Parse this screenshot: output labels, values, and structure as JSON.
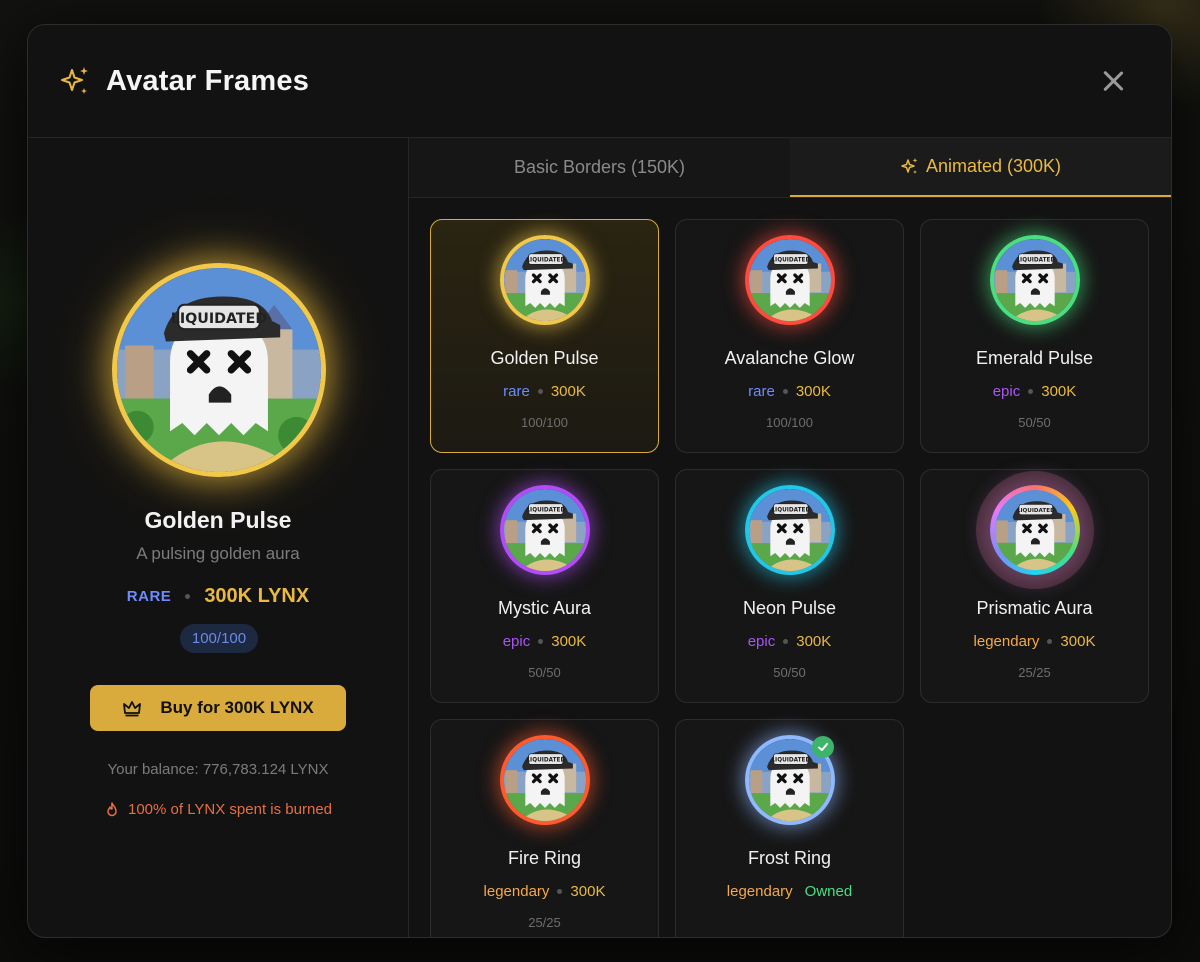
{
  "modal": {
    "title": "Avatar Frames",
    "close_icon": "close-icon",
    "title_icon": "sparkles-icon"
  },
  "preview": {
    "name": "Golden Pulse",
    "description": "A pulsing golden aura",
    "rarity": "RARE",
    "price": "300K LYNX",
    "stock": "100/100",
    "buy_label": "Buy for 300K LYNX",
    "balance": "Your balance: 776,783.124 LYNX",
    "burn_note": "100% of LYNX spent is burned",
    "avatar_cap_text": "LIQUIDATED"
  },
  "tabs": [
    {
      "label": "Basic Borders (150K)",
      "active": false
    },
    {
      "label": "Animated (300K)",
      "active": true
    }
  ],
  "frames": [
    {
      "name": "Golden Pulse",
      "rarity": "rare",
      "price": "300K",
      "stock": "100/100",
      "ring": "#f2c84b",
      "selected": true
    },
    {
      "name": "Avalanche Glow",
      "rarity": "rare",
      "price": "300K",
      "stock": "100/100",
      "ring": "#ff4b3e"
    },
    {
      "name": "Emerald Pulse",
      "rarity": "epic",
      "price": "300K",
      "stock": "50/50",
      "ring": "#4ade80"
    },
    {
      "name": "Mystic Aura",
      "rarity": "epic",
      "price": "300K",
      "stock": "50/50",
      "ring": "#b14cf6"
    },
    {
      "name": "Neon Pulse",
      "rarity": "epic",
      "price": "300K",
      "stock": "50/50",
      "ring": "#22c7e8"
    },
    {
      "name": "Prismatic Aura",
      "rarity": "legendary",
      "price": "300K",
      "stock": "25/25",
      "ring": "#e879f9"
    },
    {
      "name": "Fire Ring",
      "rarity": "legendary",
      "price": "300K",
      "stock": "25/25",
      "ring": "#ff5a2e"
    },
    {
      "name": "Frost Ring",
      "rarity": "legendary",
      "price": "",
      "stock": "",
      "owned_label": "Owned",
      "ring": "#8fb8ff",
      "owned": true
    }
  ],
  "colors": {
    "accent": "#d8ab3c",
    "rare": "#6c8cff",
    "epic": "#a855f7",
    "legendary": "#f5a94a",
    "owned": "#4ade80"
  }
}
